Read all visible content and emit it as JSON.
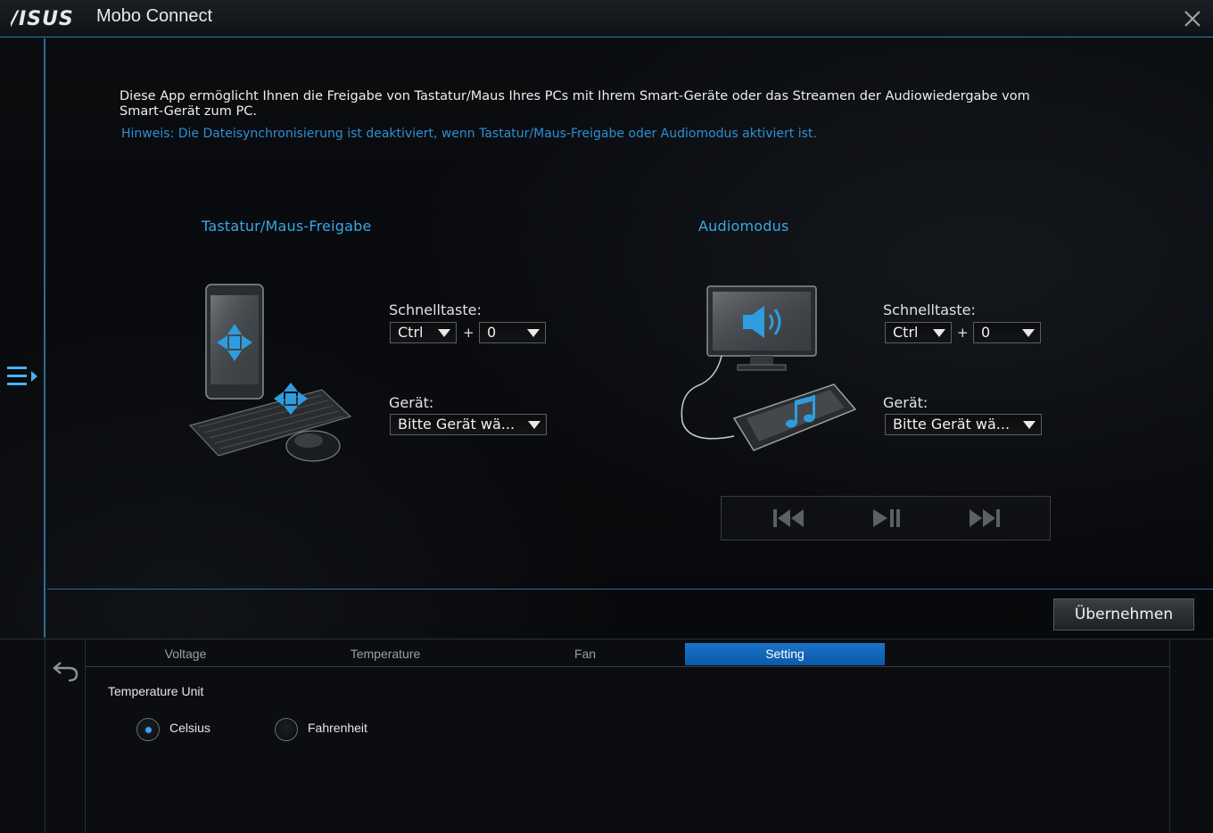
{
  "window": {
    "brand": "ASUS",
    "title": "Mobo Connect"
  },
  "main": {
    "description": "Diese App ermöglicht Ihnen die Freigabe von Tastatur/Maus Ihres PCs mit Ihrem Smart-Geräte oder das Streamen der Audiowiedergabe vom Smart-Gerät zum PC.",
    "hint": "Hinweis: Die Dateisynchronisierung ist deaktiviert, wenn Tastatur/Maus-Freigabe oder Audiomodus aktiviert ist.",
    "keyboard_mouse": {
      "title": "Tastatur/Maus-Freigabe",
      "hotkey_label": "Schnelltaste:",
      "hotkey_modifier": "Ctrl",
      "hotkey_plus": "+",
      "hotkey_key": "0",
      "device_label": "Gerät:",
      "device_value": "Bitte Gerät wä..."
    },
    "audio": {
      "title": "Audiomodus",
      "hotkey_label": "Schnelltaste:",
      "hotkey_modifier": "Ctrl",
      "hotkey_plus": "+",
      "hotkey_key": "0",
      "device_label": "Gerät:",
      "device_value": "Bitte Gerät wä..."
    },
    "media_controls": [
      "previous-icon",
      "play-pause-icon",
      "next-icon"
    ],
    "apply_label": "Übernehmen"
  },
  "bottom": {
    "tabs": [
      {
        "label": "Voltage",
        "active": false
      },
      {
        "label": "Temperature",
        "active": false
      },
      {
        "label": "Fan",
        "active": false
      },
      {
        "label": "Setting",
        "active": true
      }
    ],
    "temperature_unit_label": "Temperature Unit",
    "options": [
      {
        "label": "Celsius",
        "selected": true
      },
      {
        "label": "Fahrenheit",
        "selected": false
      }
    ]
  },
  "colors": {
    "accent_blue": "#39a7e6",
    "hint_blue": "#2c8fd6",
    "active_tab": "#1a73c9",
    "divider": "#2a6e96"
  }
}
